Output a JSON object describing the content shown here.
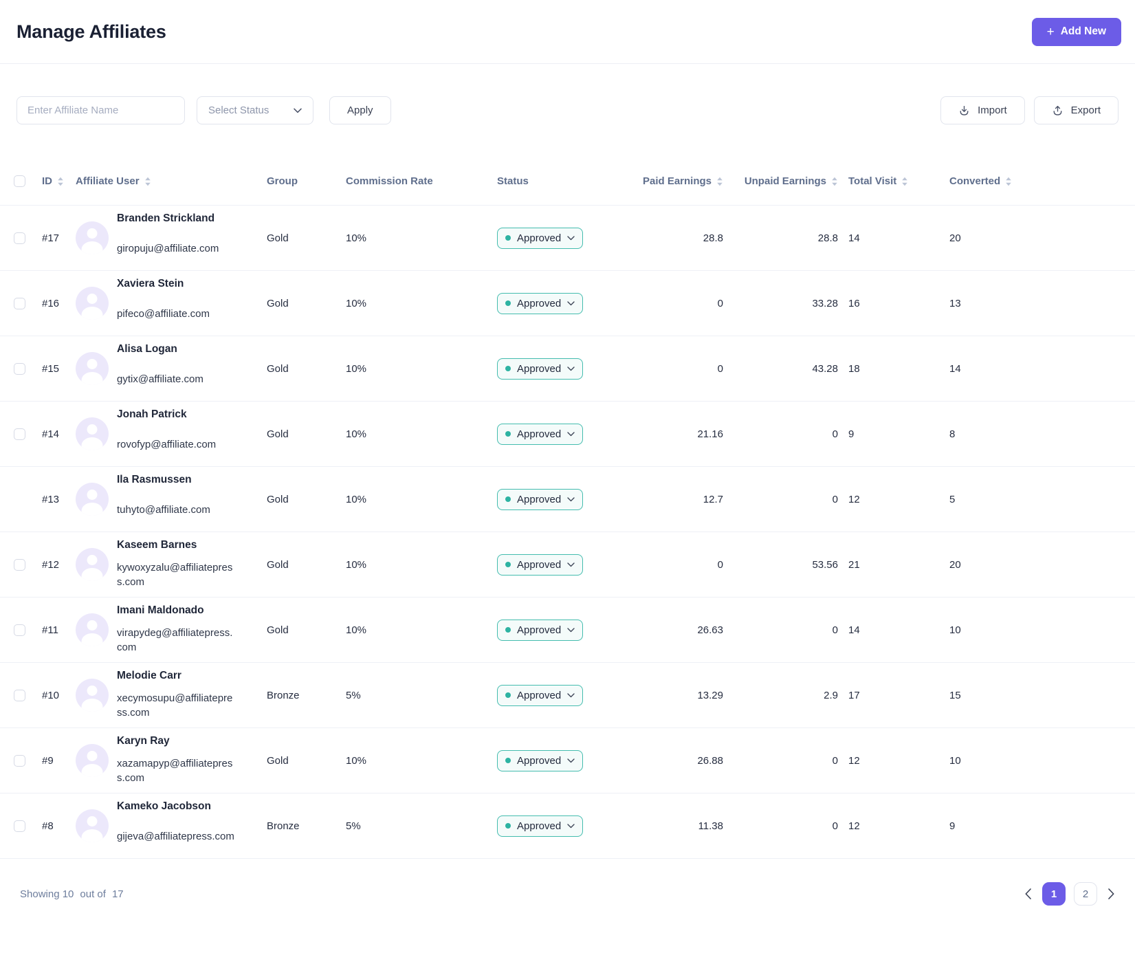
{
  "header": {
    "title": "Manage Affiliates",
    "plus_icon": "+",
    "add_new_label": "Add New"
  },
  "filters": {
    "name_placeholder": "Enter Affiliate Name",
    "status_placeholder": "Select Status",
    "apply_label": "Apply",
    "import_label": "Import",
    "export_label": "Export"
  },
  "table": {
    "columns": [
      {
        "key": "id",
        "label": "ID",
        "sortable": true
      },
      {
        "key": "user",
        "label": "Affiliate User",
        "sortable": true
      },
      {
        "key": "group",
        "label": "Group",
        "sortable": false
      },
      {
        "key": "commission",
        "label": "Commission Rate",
        "sortable": false
      },
      {
        "key": "status",
        "label": "Status",
        "sortable": false
      },
      {
        "key": "paid",
        "label": "Paid Earnings",
        "sortable": true,
        "align": "right"
      },
      {
        "key": "unpaid",
        "label": "Unpaid Earnings",
        "sortable": true,
        "align": "right"
      },
      {
        "key": "visit",
        "label": "Total Visit",
        "sortable": true
      },
      {
        "key": "converted",
        "label": "Converted",
        "sortable": true
      }
    ],
    "rows": [
      {
        "id": "#17",
        "name": "Branden Strickland",
        "email": "giropuju@affiliate.com",
        "group": "Gold",
        "commission_rate": "10%",
        "status": "Approved",
        "paid_earnings": "28.8",
        "unpaid_earnings": "28.8",
        "total_visit": "14",
        "converted": "20",
        "has_checkbox": true
      },
      {
        "id": "#16",
        "name": "Xaviera Stein",
        "email": "pifeco@affiliate.com",
        "group": "Gold",
        "commission_rate": "10%",
        "status": "Approved",
        "paid_earnings": "0",
        "unpaid_earnings": "33.28",
        "total_visit": "16",
        "converted": "13",
        "has_checkbox": true
      },
      {
        "id": "#15",
        "name": "Alisa Logan",
        "email": "gytix@affiliate.com",
        "group": "Gold",
        "commission_rate": "10%",
        "status": "Approved",
        "paid_earnings": "0",
        "unpaid_earnings": "43.28",
        "total_visit": "18",
        "converted": "14",
        "has_checkbox": true
      },
      {
        "id": "#14",
        "name": "Jonah Patrick",
        "email": "rovofyp@affiliate.com",
        "group": "Gold",
        "commission_rate": "10%",
        "status": "Approved",
        "paid_earnings": "21.16",
        "unpaid_earnings": "0",
        "total_visit": "9",
        "converted": "8",
        "has_checkbox": true
      },
      {
        "id": "#13",
        "name": "Ila Rasmussen",
        "email": "tuhyto@affiliate.com",
        "group": "Gold",
        "commission_rate": "10%",
        "status": "Approved",
        "paid_earnings": "12.7",
        "unpaid_earnings": "0",
        "total_visit": "12",
        "converted": "5",
        "has_checkbox": false
      },
      {
        "id": "#12",
        "name": "Kaseem Barnes",
        "email": "kywoxyzalu@affiliatepress.com",
        "group": "Gold",
        "commission_rate": "10%",
        "status": "Approved",
        "paid_earnings": "0",
        "unpaid_earnings": "53.56",
        "total_visit": "21",
        "converted": "20",
        "has_checkbox": true
      },
      {
        "id": "#11",
        "name": "Imani Maldonado",
        "email": "virapydeg@affiliatepress.com",
        "group": "Gold",
        "commission_rate": "10%",
        "status": "Approved",
        "paid_earnings": "26.63",
        "unpaid_earnings": "0",
        "total_visit": "14",
        "converted": "10",
        "has_checkbox": true
      },
      {
        "id": "#10",
        "name": "Melodie Carr",
        "email": "xecymosupu@affiliatepress.com",
        "group": "Bronze",
        "commission_rate": "5%",
        "status": "Approved",
        "paid_earnings": "13.29",
        "unpaid_earnings": "2.9",
        "total_visit": "17",
        "converted": "15",
        "has_checkbox": true
      },
      {
        "id": "#9",
        "name": "Karyn Ray",
        "email": "xazamapyp@affiliatepress.com",
        "group": "Gold",
        "commission_rate": "10%",
        "status": "Approved",
        "paid_earnings": "26.88",
        "unpaid_earnings": "0",
        "total_visit": "12",
        "converted": "10",
        "has_checkbox": true
      },
      {
        "id": "#8",
        "name": "Kameko Jacobson",
        "email": "gijeva@affiliatepress.com",
        "group": "Bronze",
        "commission_rate": "5%",
        "status": "Approved",
        "paid_earnings": "11.38",
        "unpaid_earnings": "0",
        "total_visit": "12",
        "converted": "9",
        "has_checkbox": true
      }
    ]
  },
  "footer": {
    "showing_parts": [
      "Showing 10",
      "out of",
      "17"
    ],
    "pages": [
      {
        "label": "1",
        "active": true
      },
      {
        "label": "2",
        "active": false
      }
    ]
  },
  "colors": {
    "accent_purple": "#6C5CE7",
    "status_teal_dot": "#2DB3A2",
    "status_teal_border": "#43BCAE",
    "status_pill_bg": "#F4FBFA"
  }
}
